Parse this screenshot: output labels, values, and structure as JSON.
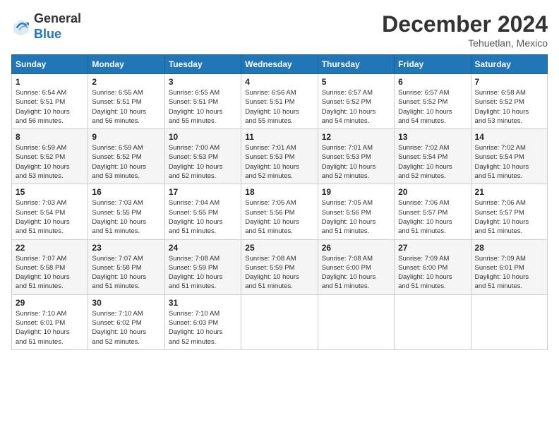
{
  "header": {
    "logo_general": "General",
    "logo_blue": "Blue",
    "title": "December 2024",
    "location": "Tehuetlan, Mexico"
  },
  "calendar": {
    "days_of_week": [
      "Sunday",
      "Monday",
      "Tuesday",
      "Wednesday",
      "Thursday",
      "Friday",
      "Saturday"
    ],
    "weeks": [
      [
        {
          "day": "",
          "info": ""
        },
        {
          "day": "2",
          "info": "Sunrise: 6:55 AM\nSunset: 5:51 PM\nDaylight: 10 hours\nand 56 minutes."
        },
        {
          "day": "3",
          "info": "Sunrise: 6:55 AM\nSunset: 5:51 PM\nDaylight: 10 hours\nand 55 minutes."
        },
        {
          "day": "4",
          "info": "Sunrise: 6:56 AM\nSunset: 5:51 PM\nDaylight: 10 hours\nand 55 minutes."
        },
        {
          "day": "5",
          "info": "Sunrise: 6:57 AM\nSunset: 5:52 PM\nDaylight: 10 hours\nand 54 minutes."
        },
        {
          "day": "6",
          "info": "Sunrise: 6:57 AM\nSunset: 5:52 PM\nDaylight: 10 hours\nand 54 minutes."
        },
        {
          "day": "7",
          "info": "Sunrise: 6:58 AM\nSunset: 5:52 PM\nDaylight: 10 hours\nand 53 minutes."
        }
      ],
      [
        {
          "day": "8",
          "info": "Sunrise: 6:59 AM\nSunset: 5:52 PM\nDaylight: 10 hours\nand 53 minutes."
        },
        {
          "day": "9",
          "info": "Sunrise: 6:59 AM\nSunset: 5:52 PM\nDaylight: 10 hours\nand 53 minutes."
        },
        {
          "day": "10",
          "info": "Sunrise: 7:00 AM\nSunset: 5:53 PM\nDaylight: 10 hours\nand 52 minutes."
        },
        {
          "day": "11",
          "info": "Sunrise: 7:01 AM\nSunset: 5:53 PM\nDaylight: 10 hours\nand 52 minutes."
        },
        {
          "day": "12",
          "info": "Sunrise: 7:01 AM\nSunset: 5:53 PM\nDaylight: 10 hours\nand 52 minutes."
        },
        {
          "day": "13",
          "info": "Sunrise: 7:02 AM\nSunset: 5:54 PM\nDaylight: 10 hours\nand 52 minutes."
        },
        {
          "day": "14",
          "info": "Sunrise: 7:02 AM\nSunset: 5:54 PM\nDaylight: 10 hours\nand 51 minutes."
        }
      ],
      [
        {
          "day": "15",
          "info": "Sunrise: 7:03 AM\nSunset: 5:54 PM\nDaylight: 10 hours\nand 51 minutes."
        },
        {
          "day": "16",
          "info": "Sunrise: 7:03 AM\nSunset: 5:55 PM\nDaylight: 10 hours\nand 51 minutes."
        },
        {
          "day": "17",
          "info": "Sunrise: 7:04 AM\nSunset: 5:55 PM\nDaylight: 10 hours\nand 51 minutes."
        },
        {
          "day": "18",
          "info": "Sunrise: 7:05 AM\nSunset: 5:56 PM\nDaylight: 10 hours\nand 51 minutes."
        },
        {
          "day": "19",
          "info": "Sunrise: 7:05 AM\nSunset: 5:56 PM\nDaylight: 10 hours\nand 51 minutes."
        },
        {
          "day": "20",
          "info": "Sunrise: 7:06 AM\nSunset: 5:57 PM\nDaylight: 10 hours\nand 51 minutes."
        },
        {
          "day": "21",
          "info": "Sunrise: 7:06 AM\nSunset: 5:57 PM\nDaylight: 10 hours\nand 51 minutes."
        }
      ],
      [
        {
          "day": "22",
          "info": "Sunrise: 7:07 AM\nSunset: 5:58 PM\nDaylight: 10 hours\nand 51 minutes."
        },
        {
          "day": "23",
          "info": "Sunrise: 7:07 AM\nSunset: 5:58 PM\nDaylight: 10 hours\nand 51 minutes."
        },
        {
          "day": "24",
          "info": "Sunrise: 7:08 AM\nSunset: 5:59 PM\nDaylight: 10 hours\nand 51 minutes."
        },
        {
          "day": "25",
          "info": "Sunrise: 7:08 AM\nSunset: 5:59 PM\nDaylight: 10 hours\nand 51 minutes."
        },
        {
          "day": "26",
          "info": "Sunrise: 7:08 AM\nSunset: 6:00 PM\nDaylight: 10 hours\nand 51 minutes."
        },
        {
          "day": "27",
          "info": "Sunrise: 7:09 AM\nSunset: 6:00 PM\nDaylight: 10 hours\nand 51 minutes."
        },
        {
          "day": "28",
          "info": "Sunrise: 7:09 AM\nSunset: 6:01 PM\nDaylight: 10 hours\nand 51 minutes."
        }
      ],
      [
        {
          "day": "29",
          "info": "Sunrise: 7:10 AM\nSunset: 6:01 PM\nDaylight: 10 hours\nand 51 minutes."
        },
        {
          "day": "30",
          "info": "Sunrise: 7:10 AM\nSunset: 6:02 PM\nDaylight: 10 hours\nand 52 minutes."
        },
        {
          "day": "31",
          "info": "Sunrise: 7:10 AM\nSunset: 6:03 PM\nDaylight: 10 hours\nand 52 minutes."
        },
        {
          "day": "",
          "info": ""
        },
        {
          "day": "",
          "info": ""
        },
        {
          "day": "",
          "info": ""
        },
        {
          "day": "",
          "info": ""
        }
      ]
    ],
    "first_week_sunday": {
      "day": "1",
      "info": "Sunrise: 6:54 AM\nSunset: 5:51 PM\nDaylight: 10 hours\nand 56 minutes."
    }
  }
}
